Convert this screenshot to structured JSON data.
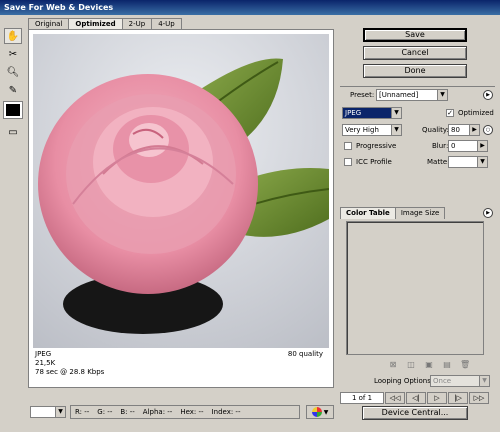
{
  "window": {
    "title": "Save For Web & Devices"
  },
  "tabs": [
    {
      "label": "Original"
    },
    {
      "label": "Optimized"
    },
    {
      "label": "2-Up"
    },
    {
      "label": "4-Up"
    }
  ],
  "tools": [
    "hand-tool-icon",
    "slice-select-icon",
    "zoom-icon",
    "eyedropper-icon"
  ],
  "preview": {
    "format": "JPEG",
    "size": "21,5K",
    "time": "78 sec @ 28.8 Kbps",
    "quality_info": "80 quality"
  },
  "buttons": {
    "save": "Save",
    "cancel": "Cancel",
    "done": "Done"
  },
  "settings": {
    "preset_label": "Preset:",
    "preset_value": "[Unnamed]",
    "format_value": "JPEG",
    "optimized_label": "Optimized",
    "optimized_checked": true,
    "quality_preset": "Very High",
    "quality_label": "Quality:",
    "quality_value": "80",
    "progressive_label": "Progressive",
    "progressive_checked": false,
    "blur_label": "Blur:",
    "blur_value": "0",
    "icc_label": "ICC Profile",
    "icc_checked": false,
    "matte_label": "Matte:"
  },
  "panel": {
    "tabs": [
      "Color Table",
      "Image Size"
    ]
  },
  "animation": {
    "looping_label": "Looping Options:",
    "looping_value": "Once",
    "frame_counter": "1 of 1"
  },
  "readouts": {
    "r": "R:  --",
    "g": "G:  --",
    "b": "B:  --",
    "alpha": "Alpha:  --",
    "hex": "Hex:  --",
    "index": "Index:  --"
  },
  "device_central": "Device Central..."
}
